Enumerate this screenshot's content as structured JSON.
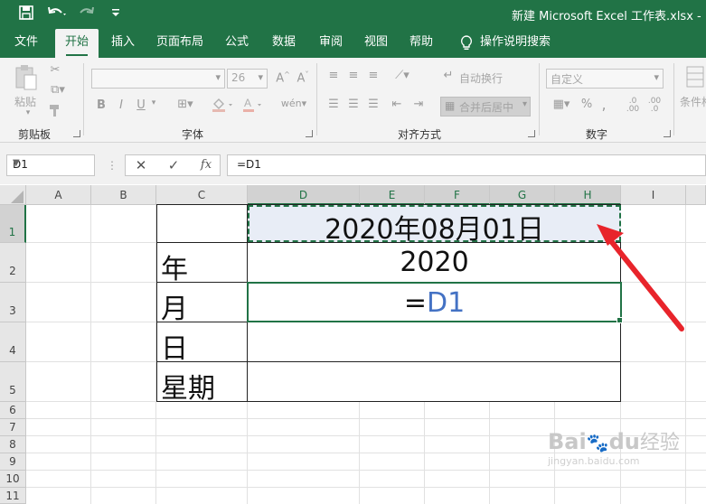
{
  "window": {
    "title": "新建 Microsoft Excel 工作表.xlsx - Ex"
  },
  "quick_access": {
    "save_icon": "save-icon",
    "undo_icon": "undo-icon",
    "redo_icon": "redo-icon",
    "customize_icon": "customize-qat-icon"
  },
  "tabs": [
    {
      "label": "文件"
    },
    {
      "label": "开始"
    },
    {
      "label": "插入"
    },
    {
      "label": "页面布局"
    },
    {
      "label": "公式"
    },
    {
      "label": "数据"
    },
    {
      "label": "审阅"
    },
    {
      "label": "视图"
    },
    {
      "label": "帮助"
    },
    {
      "label": "操作说明搜索"
    }
  ],
  "active_tab": "开始",
  "ribbon": {
    "clipboard": {
      "label": "剪贴板",
      "paste_label": "粘贴"
    },
    "font": {
      "label": "字体",
      "font_size": "26",
      "bold": "B",
      "italic": "I",
      "underline": "U"
    },
    "alignment": {
      "label": "对齐方式",
      "wrap_text": "自动换行",
      "merge_center": "合并后居中"
    },
    "number": {
      "label": "数字",
      "format": "自定义",
      "percent": "%",
      "comma": ","
    },
    "styles": {
      "conditional_format": "条件格"
    }
  },
  "formula_bar": {
    "name_box": "D1",
    "cancel": "✕",
    "enter": "✓",
    "fx": "fx",
    "formula": "=D1"
  },
  "columns": [
    "A",
    "B",
    "C",
    "D",
    "E",
    "F",
    "G",
    "H",
    "I"
  ],
  "rows": [
    "1",
    "2",
    "3",
    "4",
    "5",
    "6",
    "7",
    "8",
    "9",
    "10",
    "11"
  ],
  "cells": {
    "D1": "2020年08月01日",
    "C2": "年",
    "D2": "2020",
    "C3": "月",
    "D3_eq": "=",
    "D3_ref": "D1",
    "C4": "日",
    "C5": "星期"
  },
  "colors": {
    "excel_green": "#217346",
    "reference_blue": "#4472c4",
    "arrow_red": "#e8242b"
  },
  "watermark": {
    "brand": "Bai",
    "brand2": "du",
    "suffix": "经验",
    "url": "jingyan.baidu.com"
  }
}
